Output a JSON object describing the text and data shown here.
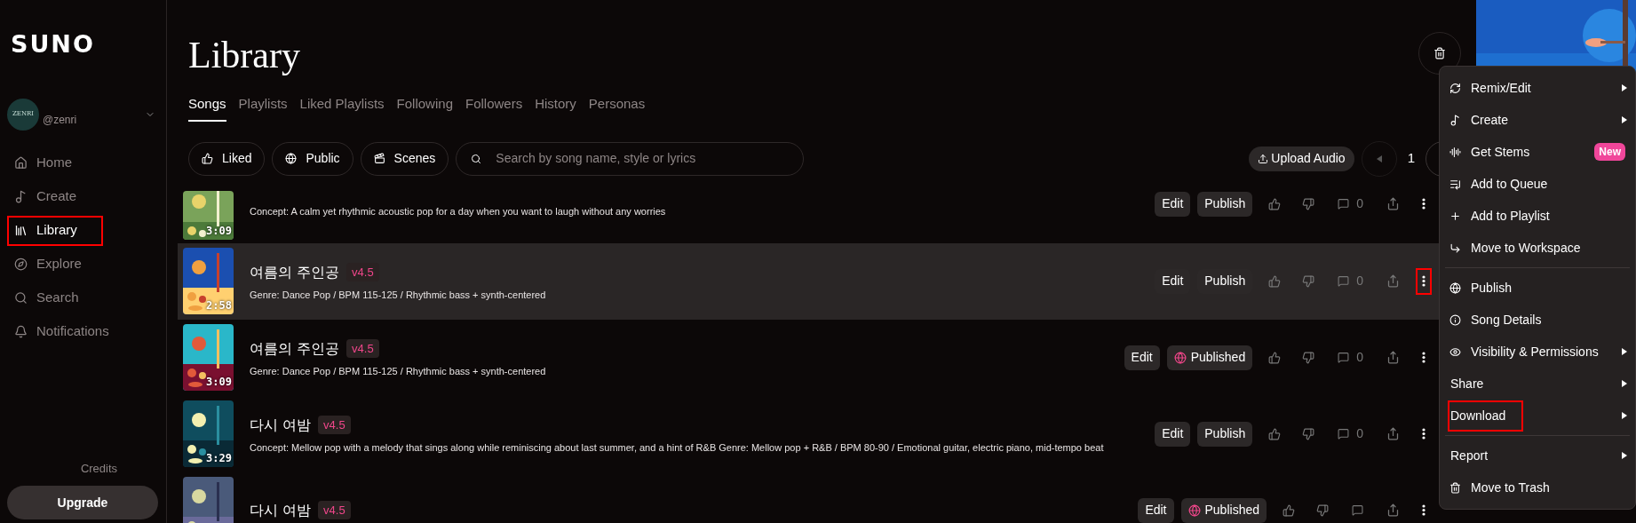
{
  "sidebar": {
    "logo": "SUNO",
    "account": {
      "avatar_text": "ZENRI",
      "handle": "@zenri"
    },
    "nav": [
      {
        "label": "Home",
        "selected": false,
        "highlighted": false
      },
      {
        "label": "Create",
        "selected": false,
        "highlighted": false
      },
      {
        "label": "Library",
        "selected": true,
        "highlighted": true
      },
      {
        "label": "Explore",
        "selected": false,
        "highlighted": false
      },
      {
        "label": "Search",
        "selected": false,
        "highlighted": false
      },
      {
        "label": "Notifications",
        "selected": false,
        "highlighted": false
      }
    ],
    "credits": "Credits",
    "upgrade": "Upgrade"
  },
  "header": {
    "title": "Library"
  },
  "tabs": [
    {
      "label": "Songs",
      "selected": true
    },
    {
      "label": "Playlists",
      "selected": false
    },
    {
      "label": "Liked Playlists",
      "selected": false
    },
    {
      "label": "Following",
      "selected": false
    },
    {
      "label": "Followers",
      "selected": false
    },
    {
      "label": "History",
      "selected": false
    },
    {
      "label": "Personas",
      "selected": false
    }
  ],
  "filters": [
    {
      "label": "Liked"
    },
    {
      "label": "Public"
    },
    {
      "label": "Scenes"
    }
  ],
  "search": {
    "placeholder": "Search by song name, style or lyrics"
  },
  "upload": "Upload Audio",
  "page": "1",
  "songs": [
    {
      "description": "Concept: A calm yet rhythmic acoustic pop for a day when you want to laugh without any worries",
      "duration": "3:09",
      "edit": "Edit",
      "publish": "Publish",
      "published": false,
      "comments": "0",
      "selected": false,
      "more_highlighted": false
    },
    {
      "title": "여름의 주인공",
      "version": "v4.5",
      "description": "Genre: Dance Pop / BPM 115-125 / Rhythmic bass + synth-centered",
      "duration": "2:58",
      "edit": "Edit",
      "publish": "Publish",
      "published": false,
      "comments": "0",
      "selected": true,
      "more_highlighted": true
    },
    {
      "title": "여름의 주인공",
      "version": "v4.5",
      "description": "Genre: Dance Pop / BPM 115-125 / Rhythmic bass + synth-centered",
      "duration": "3:09",
      "edit": "Edit",
      "publish": "Published",
      "published": true,
      "comments": "0",
      "selected": false,
      "more_highlighted": false
    },
    {
      "title": "다시 여밤",
      "version": "v4.5",
      "description": "Concept: Mellow pop with a melody that sings along while reminiscing about last summer, and a hint of R&B Genre: Mellow pop + R&B / BPM 80-90 / Emotional guitar, electric piano, mid-tempo beat",
      "duration": "3:29",
      "edit": "Edit",
      "publish": "Publish",
      "published": false,
      "comments": "0",
      "selected": false,
      "more_highlighted": false
    },
    {
      "title": "다시 여밤",
      "version": "v4.5",
      "edit": "Edit",
      "publish": "Published",
      "published": true,
      "selected": false,
      "more_highlighted": false
    }
  ],
  "menu": {
    "sections": [
      [
        {
          "label": "Remix/Edit",
          "submenu": true,
          "highlighted": false
        },
        {
          "label": "Create",
          "submenu": true,
          "highlighted": false
        },
        {
          "label": "Get Stems",
          "badge": "New",
          "submenu": false,
          "highlighted": false
        },
        {
          "label": "Add to Queue",
          "submenu": false,
          "highlighted": false
        },
        {
          "label": "Add to Playlist",
          "submenu": false,
          "highlighted": false
        },
        {
          "label": "Move to Workspace",
          "submenu": false,
          "highlighted": false
        }
      ],
      [
        {
          "label": "Publish",
          "submenu": false,
          "highlighted": false
        },
        {
          "label": "Song Details",
          "submenu": false,
          "highlighted": false
        },
        {
          "label": "Visibility & Permissions",
          "submenu": true,
          "highlighted": false
        },
        {
          "label": "Share",
          "submenu": true,
          "highlighted": false
        },
        {
          "label": "Download",
          "submenu": true,
          "highlighted": true
        }
      ],
      [
        {
          "label": "Report",
          "submenu": true,
          "highlighted": false
        },
        {
          "label": "Move to Trash",
          "submenu": false,
          "highlighted": false
        }
      ]
    ]
  }
}
